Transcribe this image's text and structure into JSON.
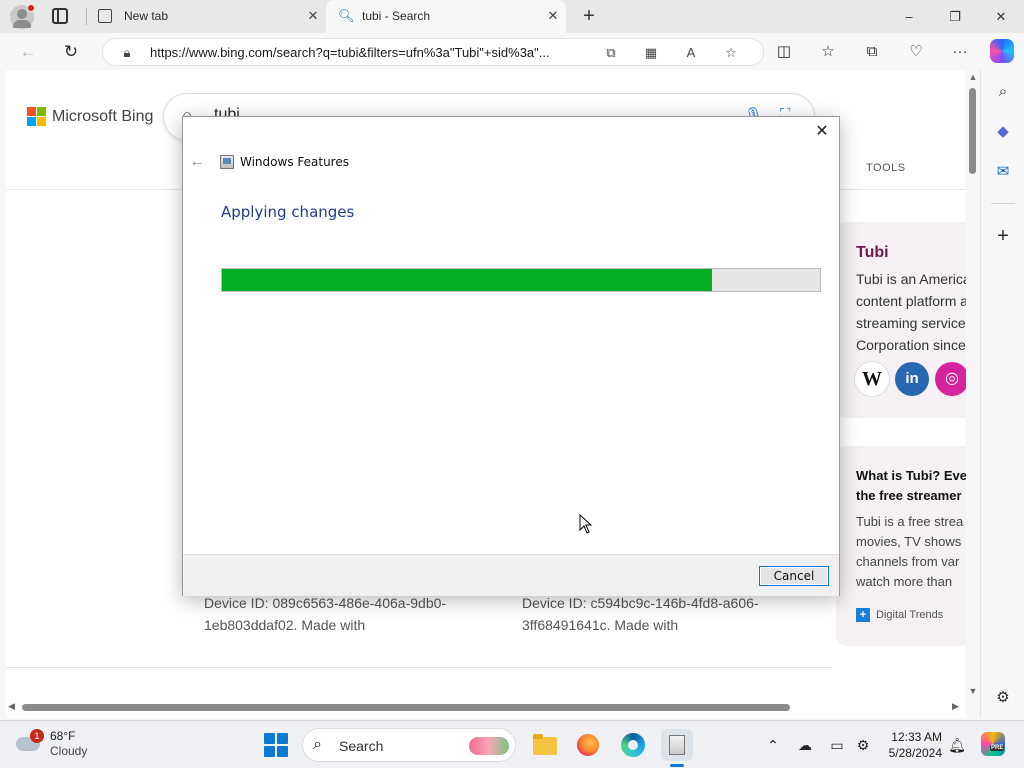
{
  "browser": {
    "tabs": [
      {
        "label": "New tab",
        "active": false
      },
      {
        "label": "tubi - Search",
        "active": true
      }
    ],
    "url": "https://www.bing.com/search?q=tubi&filters=ufn%3a\"Tubi\"+sid%3a\"...",
    "window_controls": {
      "minimize": "–",
      "restore": "❐",
      "close": "✕"
    }
  },
  "bing": {
    "logo_text": "Microsoft Bing",
    "query": "tubi",
    "tools_tab": "TOOLS"
  },
  "knowledge_card": {
    "title": "Tubi",
    "description_lines": [
      "Tubi is an America",
      "content platform a",
      "streaming service",
      "Corporation since"
    ],
    "social": {
      "wikipedia": "W",
      "linkedin": "in",
      "instagram": "◎"
    }
  },
  "article_card": {
    "title_lines": [
      "What is Tubi? Eve",
      "the free streamer"
    ],
    "description_lines": [
      "Tubi is a free strea",
      "movies, TV shows",
      "channels from var",
      "watch more than"
    ],
    "source": "Digital Trends"
  },
  "results": [
    {
      "text": "Device ID: 089c6563-486e-406a-9db0-1eb803ddaf02. Made with"
    },
    {
      "text": "Device ID: c594bc9c-146b-4fd8-a606-3ff68491641c. Made with"
    }
  ],
  "dialog": {
    "title": "Windows Features",
    "heading": "Applying changes",
    "progress_fraction": 0.82,
    "progress_color": "#06b025",
    "cancel_label": "Cancel",
    "close_glyph": "✕",
    "back_glyph": "←"
  },
  "taskbar": {
    "weather": {
      "temp": "68°F",
      "condition": "Cloudy",
      "badge": "1"
    },
    "search_label": "Search",
    "clock": {
      "time": "12:33 AM",
      "date": "5/28/2024"
    },
    "copilot_badge": "PRE"
  }
}
